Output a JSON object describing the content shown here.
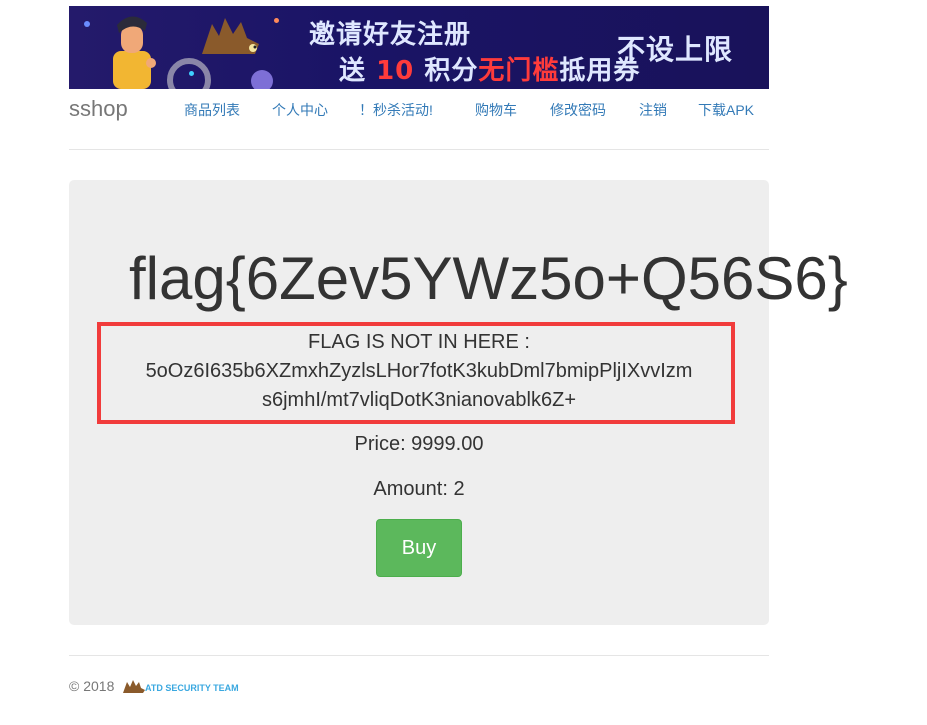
{
  "banner": {
    "line1": "邀请好友注册",
    "line2_prefix": "送",
    "line2_num": "10",
    "line2_mid": "积分",
    "line2_red": "无门槛",
    "line2_suffix": "抵用券",
    "line3": "不设上限"
  },
  "navbar": {
    "brand": "sshop",
    "links": [
      "商品列表",
      "个人中心",
      "！秒杀活动!",
      "购物车",
      "修改密码",
      "注销",
      "下载APK"
    ]
  },
  "product": {
    "title": "flag{6Zev5YWz5o+Q56S6}",
    "msg_line1": "FLAG IS NOT IN HERE :",
    "msg_line2": "5oOz6I635b6XZmxhZyzlsLHor7fotK3kubDml7bmipPljIXvvIzm",
    "msg_line3": "s6jmhI/mt7vliqDotK3nianovablk6Z+",
    "price": "Price: 9999.00",
    "amount": "Amount: 2",
    "buy_label": "Buy"
  },
  "footer": {
    "copyright": "© 2018",
    "team": "ATD SECURITY TEAM"
  },
  "colors": {
    "accent": "#337ab7",
    "buy": "#5cb85c",
    "highlight": "#f13b3b",
    "banner_bg": "#1a1466"
  }
}
